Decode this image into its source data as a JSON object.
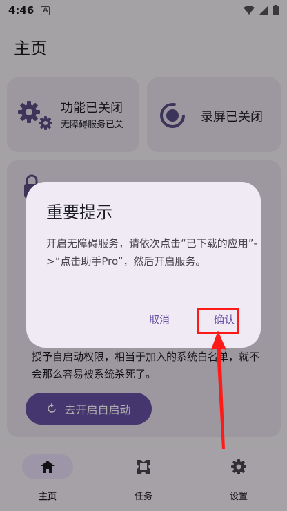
{
  "status_bar": {
    "time": "4:46",
    "notification_letter": "A"
  },
  "page": {
    "title": "主页"
  },
  "cards": {
    "function": {
      "title": "功能已关闭",
      "subtitle": "无障碍服务已关"
    },
    "recording": {
      "title": "录屏已关闭"
    },
    "autostart": {
      "description": "授予自启动权限，相当于加入的系统白名单，就不会那么容易被系统杀死了。",
      "button_label": "去开启自启动"
    }
  },
  "dialog": {
    "title": "重要提示",
    "body": "开启无障碍服务，请依次点击“已下载的应用”->“点击助手Pro”，然后开启服务。",
    "cancel_label": "取消",
    "confirm_label": "确认"
  },
  "bottom_nav": {
    "items": [
      {
        "label": "主页",
        "icon": "home-icon",
        "active": true
      },
      {
        "label": "任务",
        "icon": "puzzle-icon",
        "active": false
      },
      {
        "label": "设置",
        "icon": "gear-icon",
        "active": false
      }
    ]
  },
  "colors": {
    "accent": "#6750a4",
    "card": "#e7e0ec",
    "dialog": "#f0eaf5",
    "highlight": "#ff1a1a"
  }
}
